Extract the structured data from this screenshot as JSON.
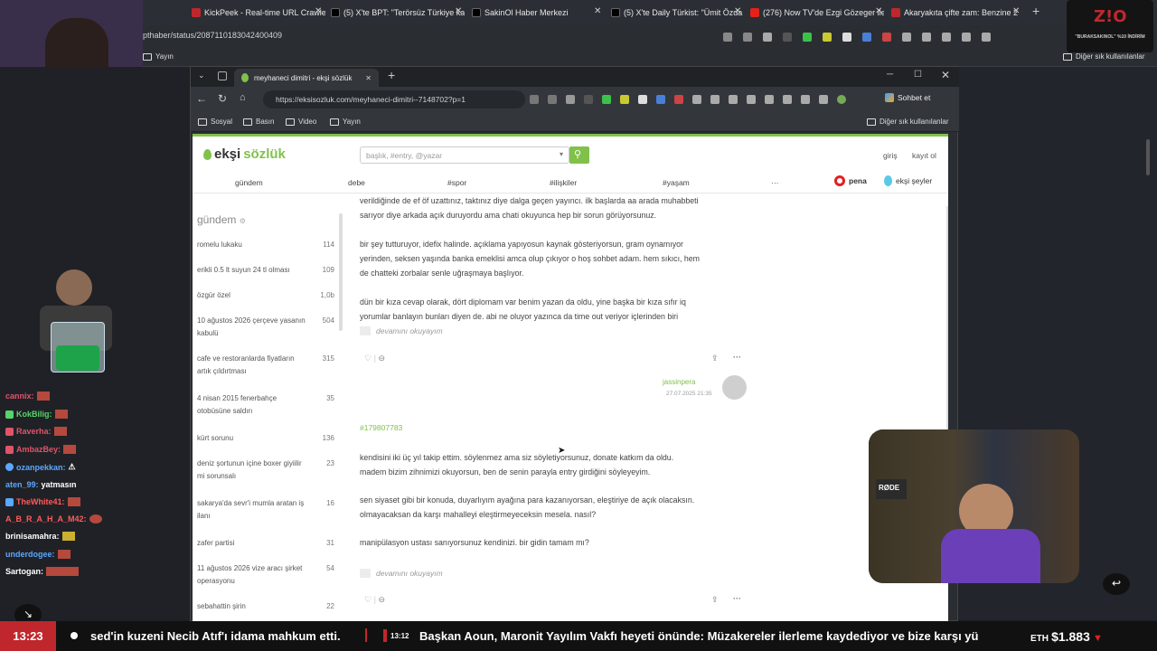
{
  "outer": {
    "tabs": [
      {
        "label": "KickPeek - Real-time URL Crawle",
        "fav": "#c0272d"
      },
      {
        "label": "(5) X'te BPT: \"Terörsüz Türkiye ka",
        "fav": "#111"
      },
      {
        "label": "SakinOl Haber Merkezi",
        "fav": "#111"
      },
      {
        "label": "(5) X'te Daily Türkist: \"Ümit Özda",
        "fav": "#111"
      },
      {
        "label": "(276) Now TV'de Ezgi Gözeger ile",
        "fav": "#e62117"
      },
      {
        "label": "Akaryakıta çifte zam: Benzine 2, m",
        "fav": "#c0272d"
      }
    ],
    "url": "pthaber/status/2087110183042400409",
    "bookmarks": {
      "yayin": "Yayın",
      "others": "Diğer sık kullanılanlar"
    }
  },
  "window": {
    "tab_title": "meyhaneci dimitri - ekşi sözlük",
    "url": "https://eksisozluk.com/meyhaneci-dimitri--7148702?p=1",
    "bookmarks": [
      "Sosyal",
      "Basın",
      "Video",
      "Yayın"
    ],
    "bookmarks_right": "Diğer sık kullanılanlar",
    "chat_button": "Sohbet et"
  },
  "site": {
    "logo_a": "ekşi",
    "logo_b": "sözlük",
    "search_placeholder": "başlık, #entry, @yazar",
    "login": "giriş",
    "register": "kayıt ol",
    "nav": [
      "gündem",
      "debe",
      "#spor",
      "#ilişkiler",
      "#yaşam",
      "···"
    ],
    "pena": "pena",
    "eksi_seyler": "ekşi şeyler"
  },
  "sidebar": {
    "title": "gündem",
    "items": [
      {
        "l1": "romelu lukaku",
        "l2": "",
        "c": "114"
      },
      {
        "l1": "erikli 0.5 lt suyun 24 tl olması",
        "l2": "",
        "c": "109"
      },
      {
        "l1": "özgür özel",
        "l2": "",
        "c": "1,0b"
      },
      {
        "l1": "10 ağustos 2026 çerçeve yasanın",
        "l2": "kabulü",
        "c": "504"
      },
      {
        "l1": "cafe ve restoranlarda fiyatların",
        "l2": "artık çıldırtması",
        "c": "315"
      },
      {
        "l1": "4 nisan 2015 fenerbahçe",
        "l2": "otobüsüne saldırı",
        "c": "35"
      },
      {
        "l1": "kürt sorunu",
        "l2": "",
        "c": "136"
      },
      {
        "l1": "deniz şortunun içine boxer giyiilir",
        "l2": "mi sorunsalı",
        "c": "23"
      },
      {
        "l1": "sakarya'da sevr'i mumla aratan iş",
        "l2": "ilanı",
        "c": "16"
      },
      {
        "l1": "zafer partisi",
        "l2": "",
        "c": "31"
      },
      {
        "l1": "11 ağustos 2026 vize aracı şirket",
        "l2": "operasyonu",
        "c": "54"
      },
      {
        "l1": "sebahattin şirin",
        "l2": "",
        "c": "22"
      }
    ]
  },
  "entry1": {
    "p1a": "verildiğinde de ef öf uzattınız, taktınız diye dalga geçen yayıncı. ilk başlarda aa arada muhabbeti",
    "p1b": "sarıyor diye arkada açık duruyordu ama chati okuyunca hep bir sorun görüyorsunuz.",
    "p2a": "bir şey tutturuyor, idefix halinde. açıklama yapıyosun kaynak gösteriyorsun, gram oynamıyor",
    "p2b": "yerinden, seksen yaşında banka emeklisi amca olup çıkıyor o hoş sohbet adam. hem sıkıcı, hem",
    "p2c": "de chatteki zorbalar senle uğraşmaya başlıyor.",
    "p3a": "dün bir kıza cevap olarak, dört diplomam var benim yazan da oldu, yine başka bir kıza sıfır iq",
    "p3b": "yorumlar banlayın bunları diyen de. abi ne oluyor yazınca da time out veriyor içlerinden biri",
    "more": "devamını okuyayım",
    "author": "jassinpera",
    "date": "27.07.2025 21:35"
  },
  "entry2": {
    "id": "#179807783",
    "p1a": "kendisini iki üç yıl takip ettim. söylenmez ama siz söyletiyorsunuz, donate katkım da oldu.",
    "p1b": "madem bizim zihnimizi okuyorsun, ben de senin parayla entry girdiğini söyleyeyim.",
    "p2a": "sen siyaset gibi bir konuda, duyarlıyım ayağına para kazanıyorsan, eleştiriye de açık olacaksın.",
    "p2b": "olmayacaksan da karşı mahalleyi eleştirmeyeceksin mesela. nasıl?",
    "p3": "manipülasyon ustası sanıyorsunuz kendinizi. bir gidin tamam mı?",
    "more": "devamını okuyayım"
  },
  "chat": [
    {
      "name": "cannix:",
      "color": "#e0546a"
    },
    {
      "name": "KokBilig:",
      "color": "#57d36b"
    },
    {
      "name": "Raverha:",
      "color": "#e0546a"
    },
    {
      "name": "AmbazBey:",
      "color": "#e0546a"
    },
    {
      "name": "ozanpekkan:",
      "color": "#5aa8ff"
    },
    {
      "name": "aten_99:",
      "color": "#5aa8ff",
      "msg": "yatmasın"
    },
    {
      "name": "TheWhite41:",
      "color": "#ff5a5a"
    },
    {
      "name": "A_B_R_A_H_A_M42:",
      "color": "#ff5a5a"
    },
    {
      "name": "brinisamahra:",
      "color": "#ffffff"
    },
    {
      "name": "underdogee:",
      "color": "#5aa8ff"
    },
    {
      "name": "Sartogan:",
      "color": "#ffffff"
    }
  ],
  "ticker": {
    "clock": "13:23",
    "t1": "sed'in kuzeni Necib Atıf'ı idama mahkum etti.",
    "t2time": "13:12",
    "t2": "Başkan Aoun, Maronit Yayılım Vakfı heyeti önünde: Müzakereler ilerleme kaydediyor ve bize karşı yü",
    "eth_label": "ETH",
    "eth_value": "$1.883"
  },
  "brand": {
    "z": "Z!O",
    "promo": "\"BURAKSAKINOL\" %10 İNDİRİM"
  },
  "colors": {
    "accent": "#81c14b",
    "ticker_red": "#c0272d"
  }
}
